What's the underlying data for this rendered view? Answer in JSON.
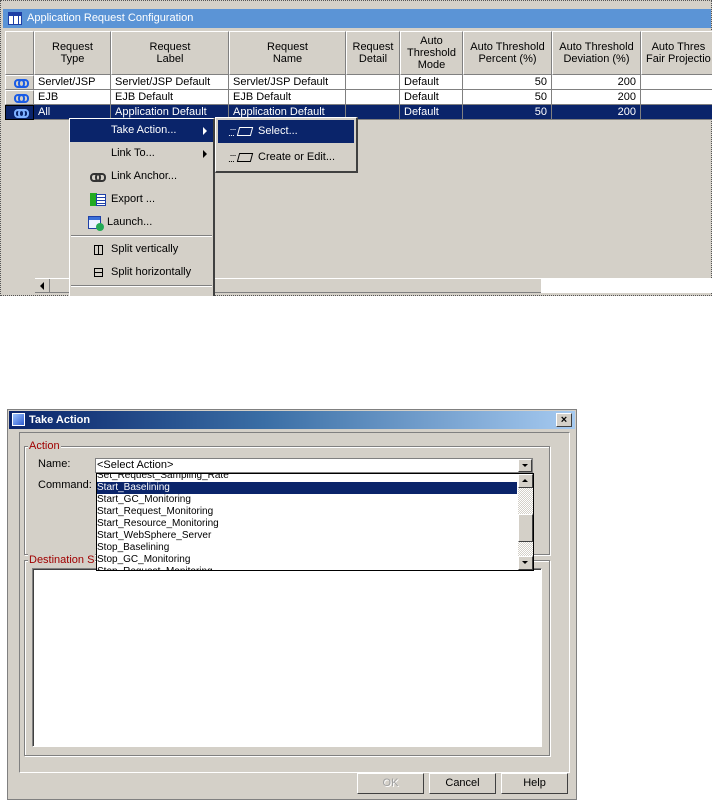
{
  "workspace": {
    "title": "Application Request Configuration",
    "columns": [
      {
        "label": "Request\nType"
      },
      {
        "label": "Request\nLabel"
      },
      {
        "label": "Request\nName"
      },
      {
        "label": "Request\nDetail"
      },
      {
        "label": "Auto\nThreshold\nMode"
      },
      {
        "label": "Auto Threshold\nPercent (%)"
      },
      {
        "label": "Auto Threshold\nDeviation (%)"
      },
      {
        "label": "Auto Thres\nFair Projectio"
      }
    ],
    "rows": [
      {
        "type": "Servlet/JSP",
        "label": "Servlet/JSP Default",
        "name": "Servlet/JSP Default",
        "detail": "",
        "mode": "Default",
        "percent": "50",
        "deviation": "200",
        "fair": "",
        "selected": false
      },
      {
        "type": "EJB",
        "label": "EJB Default",
        "name": "EJB Default",
        "detail": "",
        "mode": "Default",
        "percent": "50",
        "deviation": "200",
        "fair": "",
        "selected": false
      },
      {
        "type": "All",
        "label": "Application Default",
        "name": "Application Default",
        "detail": "",
        "mode": "Default",
        "percent": "50",
        "deviation": "200",
        "fair": "",
        "selected": true
      }
    ]
  },
  "context_menu": {
    "items": [
      {
        "label": "Take Action...",
        "icon": "none",
        "submenu": true,
        "highlighted": true
      },
      {
        "label": "Link To...",
        "icon": "none",
        "submenu": true
      },
      {
        "label": "Link Anchor...",
        "icon": "link-icon"
      },
      {
        "label": "Export ...",
        "icon": "export-icon"
      },
      {
        "label": "Launch...",
        "icon": "launch-icon"
      },
      {
        "label": "Split vertically",
        "icon": "split-vertical-icon"
      },
      {
        "label": "Split horizontally",
        "icon": "split-horizontal-icon"
      }
    ]
  },
  "submenu": {
    "items": [
      {
        "label": "Select...",
        "icon": "action-select-icon",
        "highlighted": true
      },
      {
        "label": "Create or Edit...",
        "icon": "action-edit-icon"
      }
    ]
  },
  "dialog": {
    "title": "Take Action",
    "close_label": "×",
    "action_group": "Action",
    "name_label": "Name:",
    "command_label": "Command:",
    "name_value": "<Select Action>",
    "destination_group": "Destination S",
    "options": [
      "Set_Request_Sampling_Rate",
      "Start_Baselining",
      "Start_GC_Monitoring",
      "Start_Request_Monitoring",
      "Start_Resource_Monitoring",
      "Start_WebSphere_Server",
      "Stop_Baselining",
      "Stop_GC_Monitoring",
      "Stop_Request_Monitoring"
    ],
    "selected_option": "Start_Baselining",
    "buttons": {
      "ok": "OK",
      "cancel": "Cancel",
      "help": "Help"
    },
    "ok_enabled": false
  }
}
